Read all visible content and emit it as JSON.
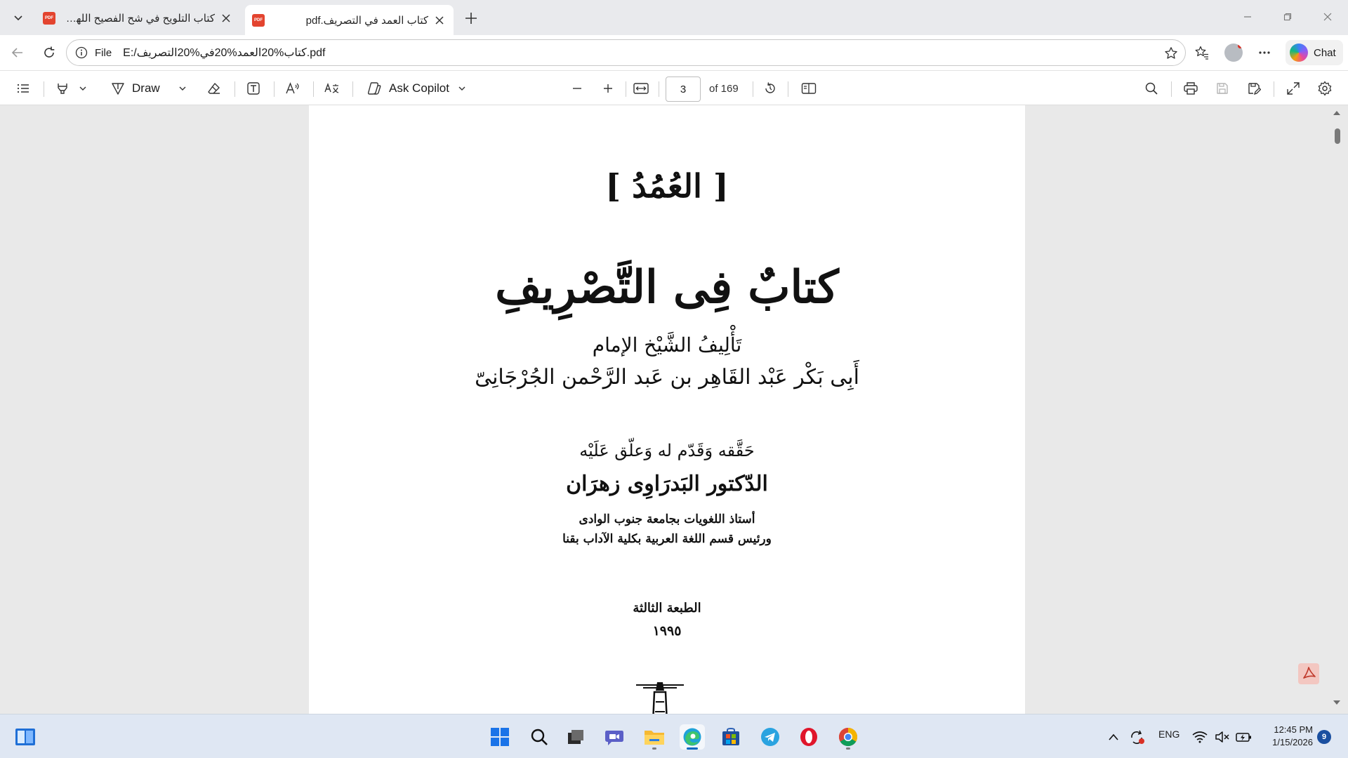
{
  "tabs": [
    {
      "title": "كتاب التلويح في شح الفصيح اللهروى",
      "active": false
    },
    {
      "title": "كتاب العمد في التصريف.pdf",
      "active": true
    }
  ],
  "address": {
    "scheme": "File",
    "url": "E:/كتاب%20العمد%20في%20التصريف.pdf"
  },
  "chat_label": "Chat",
  "pdf_toolbar": {
    "draw_label": "Draw",
    "copilot_label": "Ask Copilot",
    "page_current": "3",
    "page_total": "of 169"
  },
  "pdf_page": {
    "heading": "[ العُمُدُ ]",
    "title": "كتابٌ فِى التَّصْرِيفِ",
    "author_intro": "تَأْلِيفُ الشَّيْخ الإمام",
    "author_name": "أَبِى بَكْر عَبْد القَاهِر بن عَبد الرَّحْمن الجُرْجَانِىّ",
    "editor_intro": "حَقَّقه وَقَدّم له وَعلّق عَلَيْه",
    "editor_name": "الدّكتور البَدرَاوِى زهرَان",
    "editor_role1": "أستاذ اللغويات بجامعة جنوب الوادى",
    "editor_role2": "ورئيس قسم اللغة العربية بكلية الآداب بقنا",
    "edition": "الطبعة الثالثة",
    "year": "١٩٩٥"
  },
  "taskbar": {
    "language": "ENG",
    "time": "12:45 PM",
    "date": "1/15/2026",
    "notifications": "9"
  },
  "colors": {
    "pdf_red": "#e3442f",
    "accent_blue": "#0067c0"
  }
}
